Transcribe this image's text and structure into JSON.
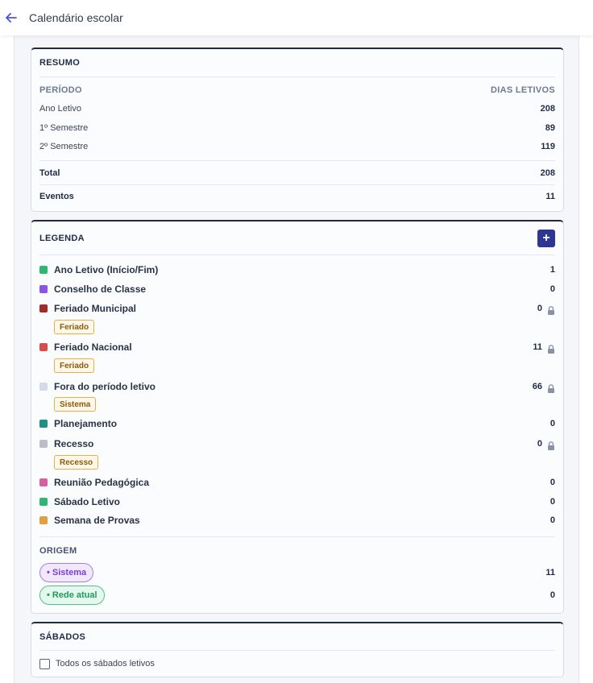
{
  "header": {
    "title": "Calendário escolar"
  },
  "resumo": {
    "title": "RESUMO",
    "col_period": "PERÍODO",
    "col_days": "DIAS LETIVOS",
    "rows": [
      {
        "label": "Ano Letivo",
        "value": "208"
      },
      {
        "label": "1º Semestre",
        "value": "89"
      },
      {
        "label": "2º Semestre",
        "value": "119"
      }
    ],
    "total_label": "Total",
    "total_value": "208",
    "eventos_label": "Eventos",
    "eventos_value": "11"
  },
  "legenda": {
    "title": "LEGENDA",
    "add_label": "+",
    "items": [
      {
        "label": "Ano Letivo (Início/Fim)",
        "count": "1",
        "color": "#2fb672"
      },
      {
        "label": "Conselho de Classe",
        "count": "0",
        "color": "#8a55e0"
      },
      {
        "label": "Feriado Municipal",
        "count": "0",
        "color": "#a12a2a",
        "tag": "Feriado",
        "locked": true
      },
      {
        "label": "Feriado Nacional",
        "count": "11",
        "color": "#d94c4c",
        "tag": "Feriado",
        "locked": true
      },
      {
        "label": "Fora do período letivo",
        "count": "66",
        "color": "#d5dbe6",
        "tag": "Sistema",
        "locked": true
      },
      {
        "label": "Planejamento",
        "count": "0",
        "color": "#1f8f86"
      },
      {
        "label": "Recesso",
        "count": "0",
        "color": "#b9bec7",
        "tag": "Recesso",
        "locked": true
      },
      {
        "label": "Reunião Pedagógica",
        "count": "0",
        "color": "#d65fa6"
      },
      {
        "label": "Sábado Letivo",
        "count": "0",
        "color": "#2fb672"
      },
      {
        "label": "Semana de Provas",
        "count": "0",
        "color": "#e3a03f"
      }
    ],
    "origem_title": "ORIGEM",
    "origem": [
      {
        "label": "• Sistema",
        "count": "11"
      },
      {
        "label": "• Rede atual",
        "count": "0"
      }
    ]
  },
  "sabados": {
    "title": "SÁBADOS",
    "checkbox_label": "Todos os sábados letivos"
  }
}
